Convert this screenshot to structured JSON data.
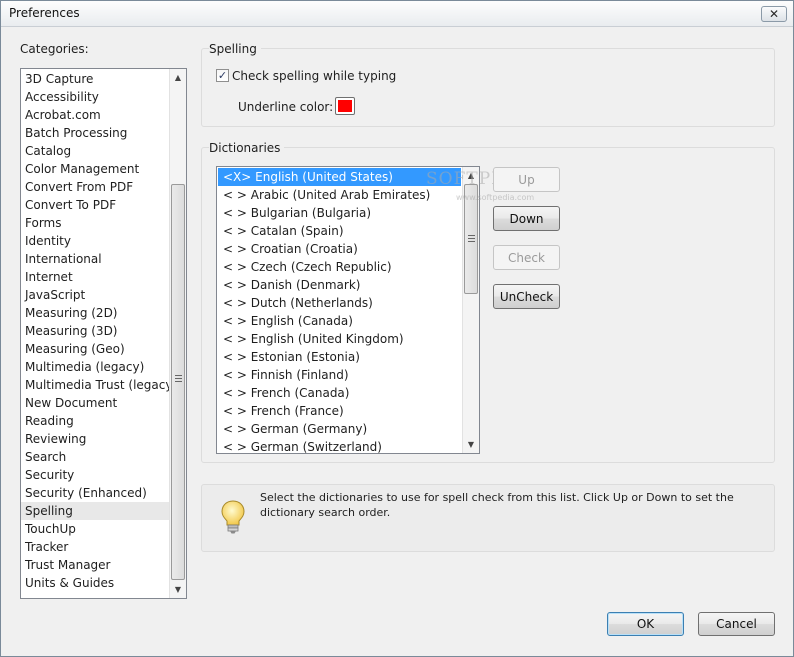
{
  "window": {
    "title": "Preferences",
    "close_glyph": "✕"
  },
  "categories": {
    "label": "Categories:",
    "selected": "Spelling",
    "items": [
      "3D Capture",
      "Accessibility",
      "Acrobat.com",
      "Batch Processing",
      "Catalog",
      "Color Management",
      "Convert From PDF",
      "Convert To PDF",
      "Forms",
      "Identity",
      "International",
      "Internet",
      "JavaScript",
      "Measuring (2D)",
      "Measuring (3D)",
      "Measuring (Geo)",
      "Multimedia (legacy)",
      "Multimedia Trust (legacy)",
      "New Document",
      "Reading",
      "Reviewing",
      "Search",
      "Security",
      "Security (Enhanced)",
      "Spelling",
      "TouchUp",
      "Tracker",
      "Trust Manager",
      "Units & Guides"
    ]
  },
  "spelling": {
    "group_title": "Spelling",
    "check_label": "Check spelling while typing",
    "check_checked": true,
    "check_glyph": "✓",
    "underline_label": "Underline color:",
    "underline_color": "#ff0000"
  },
  "dictionaries": {
    "group_title": "Dictionaries",
    "selected_index": 0,
    "items": [
      "<X> English (United States)",
      "< > Arabic (United Arab Emirates)",
      "< > Bulgarian (Bulgaria)",
      "< > Catalan (Spain)",
      "< > Croatian (Croatia)",
      "< > Czech (Czech Republic)",
      "< > Danish (Denmark)",
      "< > Dutch (Netherlands)",
      "< > English (Canada)",
      "< > English (United Kingdom)",
      "< > Estonian (Estonia)",
      "< > Finnish (Finland)",
      "< > French (Canada)",
      "< > French (France)",
      "< > German (Germany)",
      "< > German (Switzerland)"
    ],
    "buttons": {
      "up": "Up",
      "down": "Down",
      "check": "Check",
      "uncheck": "UnCheck"
    }
  },
  "watermark": {
    "main": "SOFTPEDIA",
    "sub": "www.softpedia.com"
  },
  "hint": {
    "icon": "lightbulb-icon",
    "text": "Select the dictionaries to use for spell check from this list.  Click Up or Down to set the dictionary search order."
  },
  "footer": {
    "ok": "OK",
    "cancel": "Cancel"
  },
  "scroll_glyphs": {
    "up": "▲",
    "down": "▼"
  }
}
